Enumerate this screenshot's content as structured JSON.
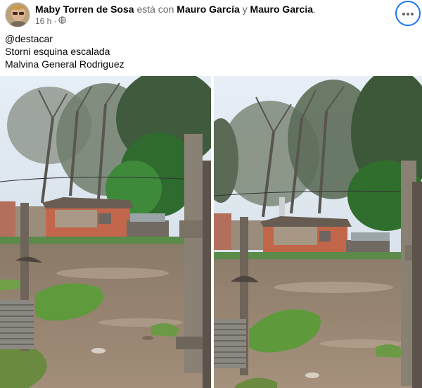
{
  "post": {
    "author": "Maby Torren de Sosa",
    "connector": "está con",
    "tag1": "Mauro García",
    "conjunction": "y",
    "tag2": "Mauro Garcia",
    "end_punct": ".",
    "time": "16 h",
    "separator": "·",
    "privacy_icon": "globe-icon",
    "more_icon": "ellipsis-icon",
    "text_lines": [
      "@destacar",
      "Storni esquina escalada",
      "Malvina General Rodriguez"
    ]
  },
  "photos": [
    {
      "name": "photo-flooded-street-left"
    },
    {
      "name": "photo-flooded-street-right"
    }
  ],
  "colors": {
    "accent": "#1877f2",
    "author_text": "#050505",
    "secondary_text": "#65676b"
  }
}
